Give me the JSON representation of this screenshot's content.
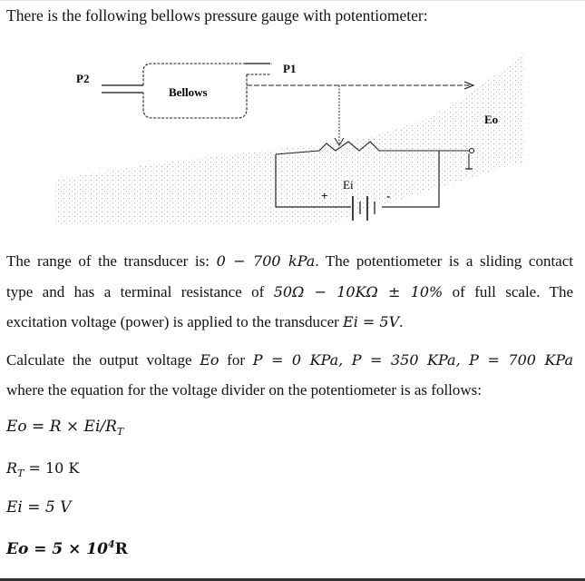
{
  "intro": "There is the following bellows pressure gauge with potentiometer:",
  "diagram": {
    "labels": {
      "p2": "P2",
      "p1": "P1",
      "bellows": "Bellows",
      "eo": "Eo",
      "ei": "Ei",
      "plus": "+",
      "minus": "-"
    }
  },
  "paragraph1": {
    "line1_text": "The range of the transducer is: ",
    "line1_math": "0 − 700 kPa",
    "line1_rest": ". The potentiometer is a sliding contact",
    "line2_text": "type and has a terminal resistance of ",
    "line2_math": "50Ω − 10KΩ ± 10%",
    "line2_rest": " of full scale. The",
    "line3_text": "excitation voltage (power) is applied to the transducer ",
    "line3_math": "Ei = 5V",
    "line3_rest": "."
  },
  "paragraph2": {
    "line1_text": "Calculate the output voltage ",
    "line1_var": "Eo",
    "line1_for": " for ",
    "line1_math": "P = 0 KPa, P = 350 KPa, P = 700 KPa",
    "line2": "where the equation for the voltage divider on the potentiometer is as follows:"
  },
  "equations": {
    "eq1_main": "Eo = R × Ei/R",
    "eq1_sub": "T",
    "eq2_main": "R",
    "eq2_sub": "T",
    "eq2_rest": " = 10 K",
    "eq3": "Ei = 5 V",
    "eq4_main": "Eo = 5 × 10",
    "eq4_sup": "4",
    "eq4_rest": "R"
  }
}
